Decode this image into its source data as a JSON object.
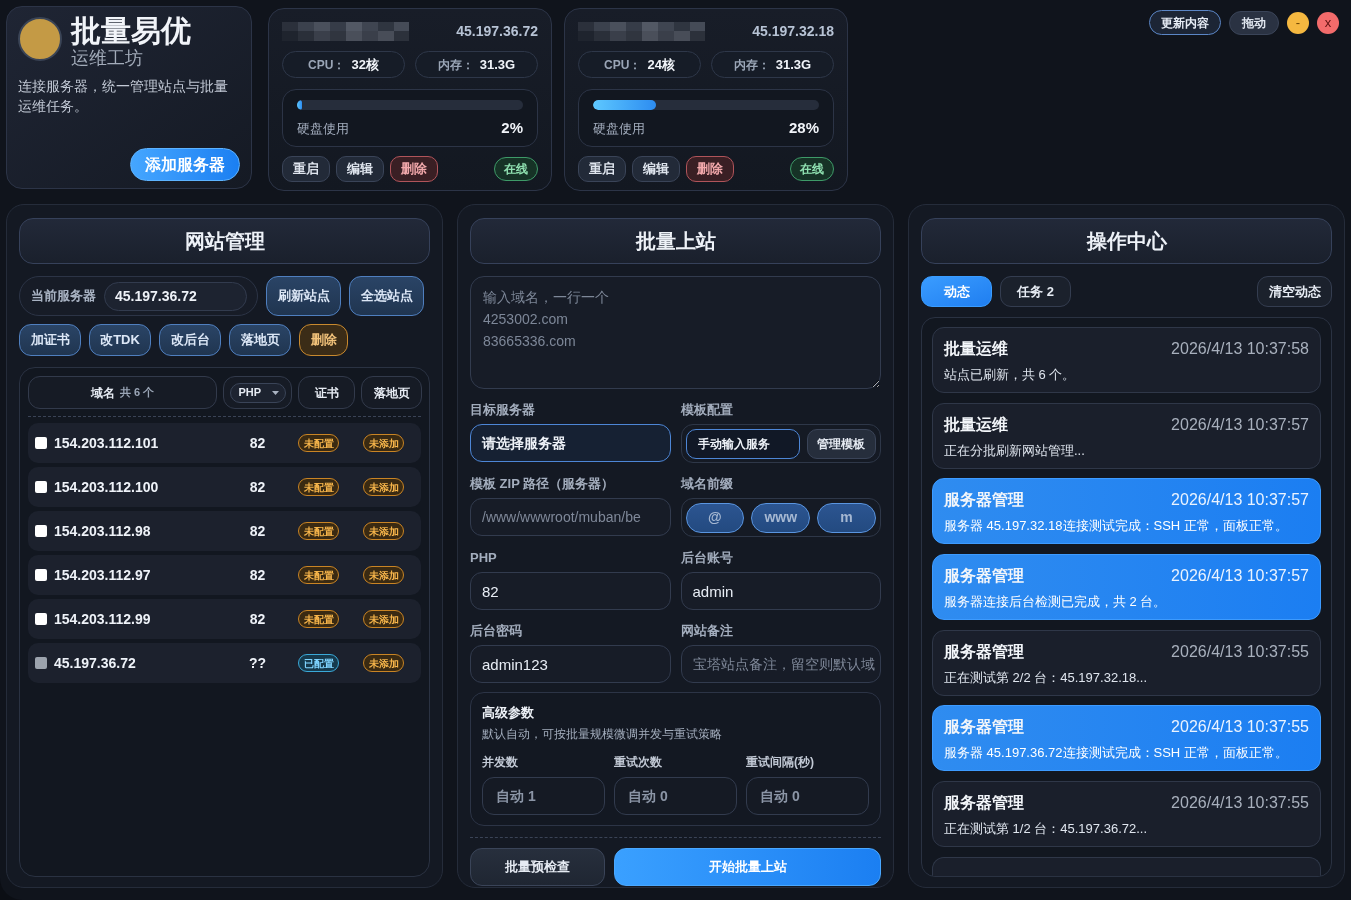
{
  "brand": {
    "title": "批量易优",
    "subtitle": "运维工坊",
    "description": "连接服务器，统一管理站点与批量运维任务。",
    "button": "添加服务器"
  },
  "servers": [
    {
      "ip": "45.197.36.72",
      "cpu_label": "CPU：",
      "cpu": "32核",
      "memory_label": "内存：",
      "memory": "31.3G",
      "disk_label": "硬盘使用",
      "level": 0.02,
      "disk_reading": "2%",
      "actions": [
        {
          "label": "重启",
          "kind": "normal"
        },
        {
          "label": "编辑",
          "kind": "normal"
        },
        {
          "label": "删除",
          "kind": "danger"
        }
      ],
      "status": {
        "label": "在线",
        "kind": "online"
      }
    },
    {
      "ip": "45.197.32.18",
      "cpu_label": "CPU：",
      "cpu": "24核",
      "memory_label": "内存：",
      "memory": "31.3G",
      "disk_label": "硬盘使用",
      "level": 0.28,
      "disk_reading": "28%",
      "actions": [
        {
          "label": "重启",
          "kind": "normal"
        },
        {
          "label": "编辑",
          "kind": "normal"
        },
        {
          "label": "删除",
          "kind": "danger"
        }
      ],
      "status": {
        "label": "在线",
        "kind": "online"
      }
    }
  ],
  "toolbar": [
    {
      "label": "更新内容",
      "kind": "outline"
    },
    {
      "label": "拖动",
      "kind": "plain"
    },
    {
      "label": "-",
      "kind": "minimize"
    },
    {
      "label": "x",
      "kind": "close"
    }
  ],
  "site_panel": {
    "title": "网站管理",
    "current_server_label": "当前服务器",
    "current_server": "45.197.36.72",
    "buttons": [
      "刷新站点",
      "全选站点"
    ],
    "actions": [
      {
        "label": "加证书",
        "kind": "normal"
      },
      {
        "label": "改TDK",
        "kind": "normal"
      },
      {
        "label": "改后台",
        "kind": "normal"
      },
      {
        "label": "落地页",
        "kind": "normal"
      },
      {
        "label": "删除",
        "kind": "danger"
      }
    ],
    "columns": [
      {
        "label": "域名",
        "count": "共 6 个",
        "kind": "text"
      },
      {
        "label": "PHP",
        "kind": "select"
      },
      {
        "label": "证书",
        "kind": "text"
      },
      {
        "label": "落地页",
        "kind": "text"
      }
    ],
    "sites": [
      {
        "domain": "154.203.112.101",
        "checked": false,
        "disabled": false,
        "php": "82",
        "cert": {
          "label": "未配置",
          "kind": "warning"
        },
        "landing": {
          "label": "未添加",
          "kind": "warning"
        }
      },
      {
        "domain": "154.203.112.100",
        "checked": false,
        "disabled": false,
        "php": "82",
        "cert": {
          "label": "未配置",
          "kind": "warning"
        },
        "landing": {
          "label": "未添加",
          "kind": "warning"
        }
      },
      {
        "domain": "154.203.112.98",
        "checked": false,
        "disabled": false,
        "php": "82",
        "cert": {
          "label": "未配置",
          "kind": "warning"
        },
        "landing": {
          "label": "未添加",
          "kind": "warning"
        }
      },
      {
        "domain": "154.203.112.97",
        "checked": false,
        "disabled": false,
        "php": "82",
        "cert": {
          "label": "未配置",
          "kind": "warning"
        },
        "landing": {
          "label": "未添加",
          "kind": "warning"
        }
      },
      {
        "domain": "154.203.112.99",
        "checked": false,
        "disabled": false,
        "php": "82",
        "cert": {
          "label": "未配置",
          "kind": "warning"
        },
        "landing": {
          "label": "未添加",
          "kind": "warning"
        }
      },
      {
        "domain": "45.197.36.72",
        "checked": false,
        "disabled": true,
        "php": "??",
        "cert": {
          "label": "已配置",
          "kind": "ok"
        },
        "landing": {
          "label": "未添加",
          "kind": "warning"
        }
      }
    ]
  },
  "deploy_panel": {
    "title": "批量上站",
    "domains": {
      "placeholder": "输入域名，一行一个\n4253002.com\n83665336.com"
    },
    "fields": [
      {
        "kind": "select",
        "label": "目标服务器",
        "value": "请选择服务器",
        "focused": true
      },
      {
        "kind": "template",
        "label": "模板配置",
        "value": "手动输入服务",
        "button": "管理模板"
      },
      {
        "kind": "input",
        "label": "模板 ZIP 路径（服务器）",
        "placeholder": "/www/wwwroot/muban/be"
      },
      {
        "kind": "prefixes",
        "label": "域名前缀",
        "options": [
          {
            "label": "@",
            "selected": true
          },
          {
            "label": "www",
            "selected": true
          },
          {
            "label": "m",
            "selected": true
          }
        ]
      },
      {
        "kind": "input",
        "label": "PHP",
        "value": "82"
      },
      {
        "kind": "input",
        "label": "后台账号",
        "value": "admin"
      },
      {
        "kind": "input",
        "label": "后台密码",
        "value": "admin123"
      },
      {
        "kind": "input",
        "label": "网站备注",
        "placeholder": "宝塔站点备注，留空则默认域"
      }
    ],
    "advanced": {
      "title": "高级参数",
      "description": "默认自动，可按批量规模微调并发与重试策略",
      "fields": [
        {
          "label": "并发数",
          "placeholder": "自动 1"
        },
        {
          "label": "重试次数",
          "placeholder": "自动 0"
        },
        {
          "label": "重试间隔(秒)",
          "placeholder": "自动 0"
        }
      ]
    },
    "buttons": [
      {
        "label": "批量预检查",
        "kind": "secondary"
      },
      {
        "label": "开始批量上站",
        "kind": "primary"
      }
    ]
  },
  "ops_panel": {
    "title": "操作中心",
    "tabs": [
      {
        "label": "动态",
        "selected": true
      },
      {
        "label": "任务 2",
        "selected": false
      }
    ],
    "clear_button": "清空动态",
    "events": [
      {
        "title": "批量运维",
        "time": "2026/4/13 10:37:58",
        "message": "站点已刷新，共 6 个。",
        "highlighted": false
      },
      {
        "title": "批量运维",
        "time": "2026/4/13 10:37:57",
        "message": "正在分批刷新网站管理...",
        "highlighted": false
      },
      {
        "title": "服务器管理",
        "time": "2026/4/13 10:37:57",
        "message": "服务器 45.197.32.18连接测试完成：SSH 正常，面板正常。",
        "highlighted": true
      },
      {
        "title": "服务器管理",
        "time": "2026/4/13 10:37:57",
        "message": "服务器连接后台检测已完成，共 2 台。",
        "highlighted": true
      },
      {
        "title": "服务器管理",
        "time": "2026/4/13 10:37:55",
        "message": "正在测试第 2/2 台：45.197.32.18...",
        "highlighted": false
      },
      {
        "title": "服务器管理",
        "time": "2026/4/13 10:37:55",
        "message": "服务器 45.197.36.72连接测试完成：SSH 正常，面板正常。",
        "highlighted": true
      },
      {
        "title": "服务器管理",
        "time": "2026/4/13 10:37:55",
        "message": "正在测试第 1/2 台：45.197.36.72...",
        "highlighted": false
      }
    ]
  }
}
